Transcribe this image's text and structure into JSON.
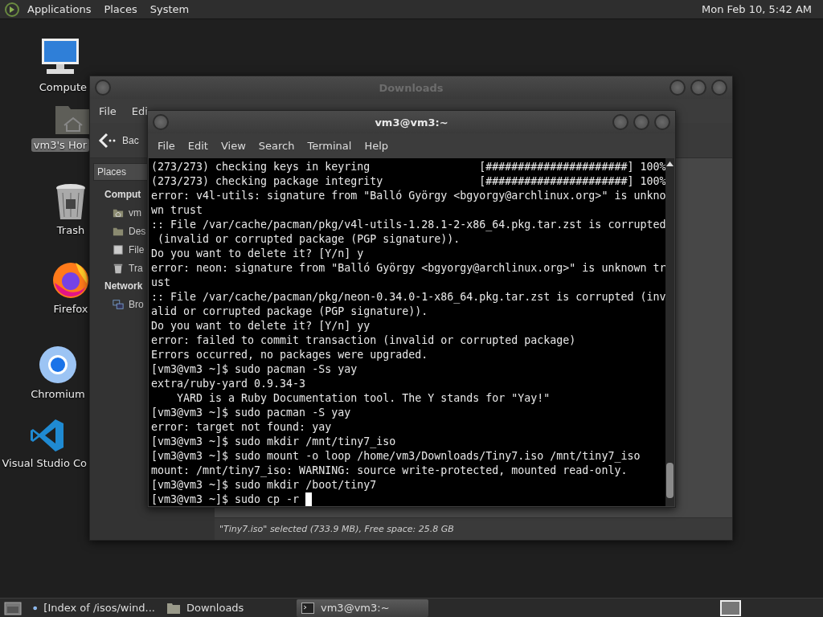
{
  "top_panel": {
    "menus": [
      "Applications",
      "Places",
      "System"
    ],
    "clock": "Mon Feb 10, 5:42 AM"
  },
  "desktop_icons": [
    {
      "kind": "computer",
      "label": "Compute",
      "selected": false
    },
    {
      "kind": "home",
      "label": "vm3's Hor",
      "selected": true
    },
    {
      "kind": "trash",
      "label": "Trash",
      "selected": false
    },
    {
      "kind": "firefox",
      "label": "Firefox",
      "selected": false
    },
    {
      "kind": "chromium",
      "label": "Chromium",
      "selected": false
    },
    {
      "kind": "vscode",
      "label": "Visual Studio Co",
      "selected": false
    }
  ],
  "file_manager": {
    "title": "Downloads",
    "active": false,
    "menu": [
      "File",
      "Edi"
    ],
    "back": "Bac",
    "places_tab": "Places",
    "sidebar": [
      {
        "heading": "Comput",
        "items": [
          {
            "kind": "home",
            "label": "vm"
          },
          {
            "kind": "desktop",
            "label": "Des"
          },
          {
            "kind": "filesystem",
            "label": "File"
          },
          {
            "kind": "trash",
            "label": "Tra"
          }
        ]
      },
      {
        "heading": "Network",
        "items": [
          {
            "kind": "network",
            "label": "Bro"
          }
        ]
      }
    ],
    "status": "\"Tiny7.iso\" selected (733.9 MB), Free space: 25.8 GB"
  },
  "terminal": {
    "title": "vm3@vm3:~",
    "active": true,
    "menu": [
      "File",
      "Edit",
      "View",
      "Search",
      "Terminal",
      "Help"
    ],
    "lines": [
      "(273/273) checking keys in keyring                 [######################] 100%",
      "(273/273) checking package integrity               [######################] 100%",
      "error: v4l-utils: signature from \"Balló György <bgyorgy@archlinux.org>\" is unkno",
      "wn trust",
      ":: File /var/cache/pacman/pkg/v4l-utils-1.28.1-2-x86_64.pkg.tar.zst is corrupted",
      " (invalid or corrupted package (PGP signature)).",
      "Do you want to delete it? [Y/n] y",
      "error: neon: signature from \"Balló György <bgyorgy@archlinux.org>\" is unknown tr",
      "ust",
      ":: File /var/cache/pacman/pkg/neon-0.34.0-1-x86_64.pkg.tar.zst is corrupted (inv",
      "alid or corrupted package (PGP signature)).",
      "Do you want to delete it? [Y/n] yy",
      "error: failed to commit transaction (invalid or corrupted package)",
      "Errors occurred, no packages were upgraded.",
      "[vm3@vm3 ~]$ sudo pacman -Ss yay",
      "extra/ruby-yard 0.9.34-3",
      "    YARD is a Ruby Documentation tool. The Y stands for \"Yay!\"",
      "[vm3@vm3 ~]$ sudo pacman -S yay",
      "error: target not found: yay",
      "[vm3@vm3 ~]$ sudo mkdir /mnt/tiny7_iso",
      "[vm3@vm3 ~]$ sudo mount -o loop /home/vm3/Downloads/Tiny7.iso /mnt/tiny7_iso",
      "mount: /mnt/tiny7_iso: WARNING: source write-protected, mounted read-only.",
      "[vm3@vm3 ~]$ sudo mkdir /boot/tiny7",
      "[vm3@vm3 ~]$ sudo cp -r"
    ]
  },
  "taskbar": {
    "items": [
      {
        "kind": "browser",
        "label": "[Index of /isos/wind...",
        "selected": false
      },
      {
        "kind": "folder",
        "label": "Downloads",
        "selected": false
      },
      {
        "kind": "terminal",
        "label": "vm3@vm3:~",
        "selected": true
      }
    ]
  }
}
